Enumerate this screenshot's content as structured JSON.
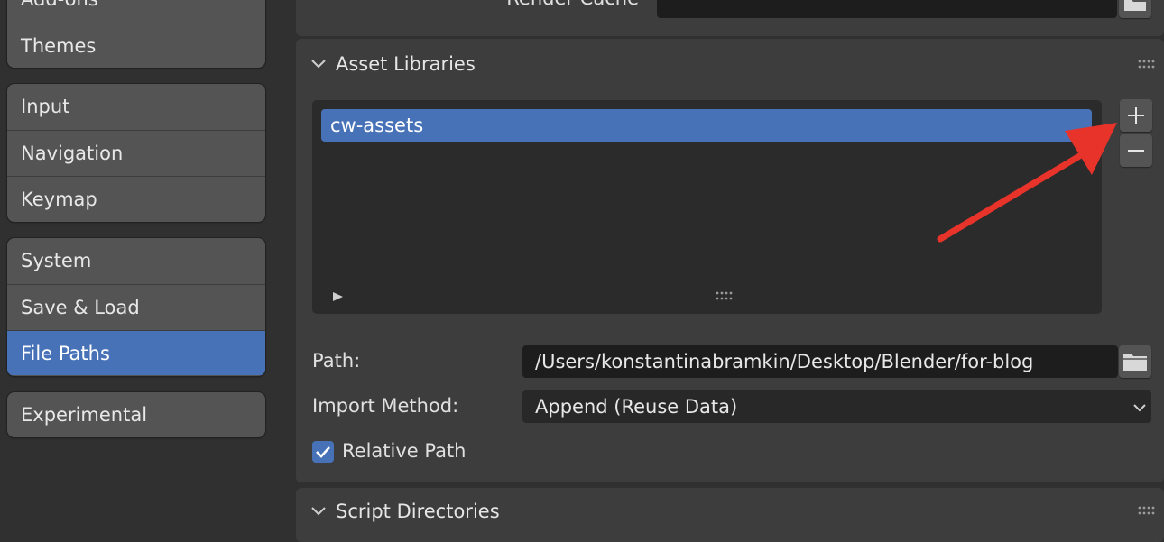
{
  "sidebar": {
    "group1": [
      {
        "label": "Add-ons"
      },
      {
        "label": "Themes"
      }
    ],
    "group2": [
      {
        "label": "Input"
      },
      {
        "label": "Navigation"
      },
      {
        "label": "Keymap"
      }
    ],
    "group3": [
      {
        "label": "System"
      },
      {
        "label": "Save & Load"
      },
      {
        "label": "File Paths"
      }
    ],
    "group4": [
      {
        "label": "Experimental"
      }
    ]
  },
  "render_cache": {
    "label": "Render Cache",
    "value": ""
  },
  "asset_libraries": {
    "title": "Asset Libraries",
    "libraries": [
      {
        "name": "cw-assets"
      }
    ],
    "add_icon": "plus-icon",
    "remove_icon": "minus-icon",
    "path_label": "Path:",
    "path_value": "/Users/konstantinabramkin/Desktop/Blender/for-blog",
    "import_method_label": "Import Method:",
    "import_method_value": "Append (Reuse Data)",
    "relative_path_label": "Relative Path",
    "relative_path_checked": true
  },
  "script_directories": {
    "title": "Script Directories"
  },
  "annotation": {
    "type": "arrow",
    "color": "#e8332a"
  },
  "colors": {
    "accent": "#4872b8",
    "panel": "#3d3d3d",
    "field": "#1d1d1d",
    "button": "#545454"
  }
}
